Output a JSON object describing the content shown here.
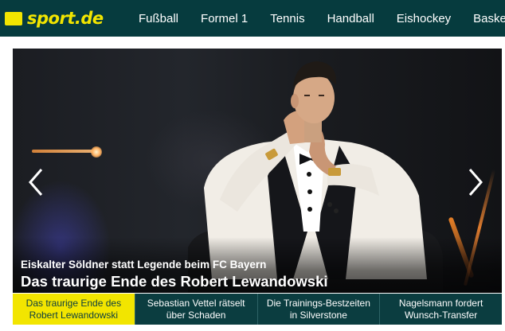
{
  "header": {
    "logo_text": "sport.de",
    "nav": [
      "Fußball",
      "Formel 1",
      "Tennis",
      "Handball",
      "Eishockey",
      "Basketball"
    ]
  },
  "hero": {
    "kicker": "Eiskalter Söldner statt Legende beim FC Bayern",
    "headline": "Das traurige Ende des Robert Lewandowski",
    "prev_icon": "chevron-left-icon",
    "next_icon": "chevron-right-icon"
  },
  "teasers": [
    {
      "line1": "Das traurige Ende des",
      "line2": "Robert Lewandowski",
      "active": true
    },
    {
      "line1": "Sebastian Vettel rätselt",
      "line2": "über Schaden",
      "active": false
    },
    {
      "line1": "Die Trainings-Bestzeiten",
      "line2": "in Silverstone",
      "active": false
    },
    {
      "line1": "Nagelsmann fordert",
      "line2": "Wunsch-Transfer",
      "active": false
    }
  ],
  "colors": {
    "brand_dark": "#063b3e",
    "brand_yellow": "#f2e500",
    "teaser_bg": "#0b3d40"
  }
}
